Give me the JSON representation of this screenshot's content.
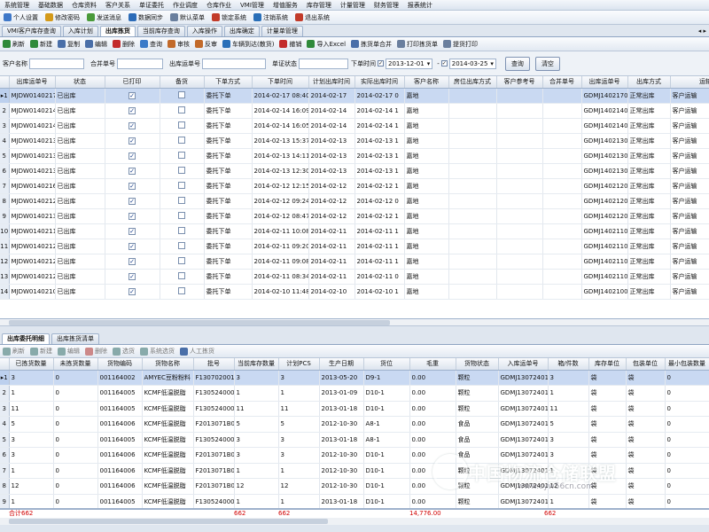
{
  "menu": [
    "系统管理",
    "基础数据",
    "仓库资料",
    "客户关系",
    "单证委托",
    "作业调度",
    "仓库作业",
    "VMI管理",
    "增值服务",
    "库存管理",
    "计量管理",
    "财务管理",
    "报表统计"
  ],
  "quickbar": [
    {
      "label": "个人设置",
      "icon": "person-icon",
      "color": "#3f78c8"
    },
    {
      "label": "修改密码",
      "icon": "key-icon",
      "color": "#d49a1a"
    },
    {
      "label": "发送消息",
      "icon": "message-icon",
      "color": "#4a9a3a"
    },
    {
      "label": "数据同步",
      "icon": "sync-icon",
      "color": "#2d6cb8"
    },
    {
      "label": "默认菜单",
      "icon": "menu-icon",
      "color": "#6a7f9e"
    },
    {
      "label": "锁定系统",
      "icon": "lock-icon",
      "color": "#c23b2a"
    },
    {
      "label": "注销系统",
      "icon": "logout-icon",
      "color": "#2a6fb8"
    },
    {
      "label": "退出系统",
      "icon": "exit-icon",
      "color": "#c23b2a"
    }
  ],
  "tabs": [
    "VMI客户库存查询",
    "入库计划",
    "出库拣货",
    "当前库存查询",
    "入库操作",
    "出库确定",
    "计量单管理"
  ],
  "active_tab": 2,
  "toolbar": [
    {
      "label": "刷新",
      "icon": "refresh-icon",
      "color": "#2f8a3a"
    },
    {
      "label": "新建",
      "icon": "new-icon",
      "color": "#2f8a3a"
    },
    {
      "label": "复制",
      "icon": "copy-icon",
      "color": "#4a6fa8"
    },
    {
      "label": "编辑",
      "icon": "edit-icon",
      "color": "#4a6fa8"
    },
    {
      "label": "删除",
      "icon": "delete-icon",
      "color": "#c32b2b"
    },
    {
      "label": "查询",
      "icon": "search-icon",
      "color": "#3a7ac8"
    },
    {
      "label": "审核",
      "icon": "approve-icon",
      "color": "#c26a2a"
    },
    {
      "label": "反审",
      "icon": "unapprove-icon",
      "color": "#c26a2a"
    },
    {
      "label": "车辆到达(散货)",
      "icon": "truck-icon",
      "color": "#2a6fb8"
    },
    {
      "label": "撤销",
      "icon": "undo-icon",
      "color": "#c32b2b"
    },
    {
      "label": "导入Excel",
      "icon": "excel-icon",
      "color": "#2f8a3a"
    },
    {
      "label": "拣货单合并",
      "icon": "merge-icon",
      "color": "#4a6fa8"
    },
    {
      "label": "打印拣货单",
      "icon": "print-icon",
      "color": "#6a7f9e"
    },
    {
      "label": "提货打印",
      "icon": "print-icon",
      "color": "#6a7f9e"
    }
  ],
  "filters": {
    "customer_label": "客户名称",
    "contract_label": "合并单号",
    "outbound_label": "出库运单号",
    "doc_status_label": "单证状态",
    "order_time_label": "下单时间",
    "date_from": "2013-12-01",
    "date_to": "2014-03-25",
    "query_button": "查询",
    "clear_button": "清空"
  },
  "grid1": {
    "columns": [
      "",
      "出库运单号",
      "状态",
      "已打印",
      "备货",
      "下单方式",
      "下单时间",
      "计划出库时间",
      "实际出库时间",
      "客户名称",
      "房位出库方式",
      "客户参考号",
      "合并单号",
      "出库运单号",
      "出库方式",
      "运输方式"
    ],
    "selected_row": 0,
    "rows": [
      [
        "1",
        "MJDW0140217001",
        "已出库",
        "✓",
        "",
        "委托下单",
        "2014-02-17 08:40",
        "2014-02-17",
        "2014-02-17 0",
        "嘉地",
        "",
        "",
        "",
        "GDMJ14021701",
        "正常出库",
        "客户运输"
      ],
      [
        "2",
        "MJDW0140214002",
        "已出库",
        "✓",
        "",
        "委托下单",
        "2014-02-14 16:09",
        "2014-02-14",
        "2014-02-14 1",
        "嘉地",
        "",
        "",
        "",
        "GDMJ14021402",
        "正常出库",
        "客户运输"
      ],
      [
        "3",
        "MJDW0140214001",
        "已出库",
        "✓",
        "",
        "委托下单",
        "2014-02-14 16:05",
        "2014-02-14",
        "2014-02-14 1",
        "嘉地",
        "",
        "",
        "",
        "GDMJ14021401",
        "正常出库",
        "客户运输"
      ],
      [
        "4",
        "MJDW0140213004",
        "已出库",
        "✓",
        "",
        "委托下单",
        "2014-02-13 15:37",
        "2014-02-13",
        "2014-02-13 1",
        "嘉地",
        "",
        "",
        "",
        "GDMJ14021304",
        "正常出库",
        "客户运输"
      ],
      [
        "5",
        "MJDW0140213003",
        "已出库",
        "✓",
        "",
        "委托下单",
        "2014-02-13 14:11",
        "2014-02-13",
        "2014-02-13 1",
        "嘉地",
        "",
        "",
        "",
        "GDMJ14021303",
        "正常出库",
        "客户运输"
      ],
      [
        "6",
        "MJDW0140213005",
        "已出库",
        "✓",
        "",
        "委托下单",
        "2014-02-13 12:30",
        "2014-02-13",
        "2014-02-13 1",
        "嘉地",
        "",
        "",
        "",
        "GDMJ14021305",
        "正常出库",
        "客户运输"
      ],
      [
        "7",
        "MJDW0140216001",
        "已出库",
        "✓",
        "",
        "委托下单",
        "2014-02-12 12:15",
        "2014-02-12",
        "2014-02-12 1",
        "嘉地",
        "",
        "",
        "",
        "GDMJ14021203",
        "正常出库",
        "客户运输"
      ],
      [
        "8",
        "MJDW0140212005",
        "已出库",
        "✓",
        "",
        "委托下单",
        "2014-02-12 09:24",
        "2014-02-12",
        "2014-02-12 0",
        "嘉地",
        "",
        "",
        "",
        "GDMJ14021201",
        "正常出库",
        "客户运输"
      ],
      [
        "9",
        "MJDW0140213001",
        "已出库",
        "✓",
        "",
        "委托下单",
        "2014-02-12 08:47",
        "2014-02-12",
        "2014-02-12 1",
        "嘉地",
        "",
        "",
        "",
        "GDMJ14021202",
        "正常出库",
        "客户运输"
      ],
      [
        "10",
        "MJDW0140211004",
        "已出库",
        "✓",
        "",
        "委托下单",
        "2014-02-11 10:08",
        "2014-02-11",
        "2014-02-11 1",
        "嘉地",
        "",
        "",
        "",
        "GDMJ14021104",
        "正常出库",
        "客户运输"
      ],
      [
        "11",
        "MJDW0140212004",
        "已出库",
        "✓",
        "",
        "委托下单",
        "2014-02-11 09:20",
        "2014-02-11",
        "2014-02-11 1",
        "嘉地",
        "",
        "",
        "",
        "GDMJ14021103",
        "正常出库",
        "客户运输"
      ],
      [
        "12",
        "MJDW0140212002",
        "已出库",
        "✓",
        "",
        "委托下单",
        "2014-02-11 09:08",
        "2014-02-11",
        "2014-02-11 1",
        "嘉地",
        "",
        "",
        "",
        "GDMJ14021102",
        "正常出库",
        "客户运输"
      ],
      [
        "13",
        "MJDW0140212001",
        "已出库",
        "✓",
        "",
        "委托下单",
        "2014-02-11 08:34",
        "2014-02-11",
        "2014-02-11 0",
        "嘉地",
        "",
        "",
        "",
        "GDMJ14021101",
        "正常出库",
        "客户运输"
      ],
      [
        "14",
        "MJDW0140210002",
        "已出库",
        "✓",
        "",
        "委托下单",
        "2014-02-10 11:48",
        "2014-02-10",
        "2014-02-10 1",
        "嘉地",
        "",
        "",
        "",
        "GDMJ14021001",
        "正常出库",
        "客户运输"
      ]
    ]
  },
  "tabs2": [
    "出库委托明细",
    "出库拣货清单"
  ],
  "toolbar2": [
    {
      "label": "刷新",
      "icon": "refresh-icon",
      "color": "#8aa"
    },
    {
      "label": "新建",
      "icon": "new-icon",
      "color": "#8aa"
    },
    {
      "label": "编辑",
      "icon": "edit-icon",
      "color": "#8aa"
    },
    {
      "label": "删除",
      "icon": "delete-icon",
      "color": "#c88"
    },
    {
      "label": "选货",
      "icon": "pick-icon",
      "color": "#8aa"
    },
    {
      "label": "系统选货",
      "icon": "auto-pick-icon",
      "color": "#8aa"
    },
    {
      "label": "人工拣货",
      "icon": "manual-pick-icon",
      "color": "#4a6fa8"
    }
  ],
  "grid2": {
    "columns": [
      "",
      "已拣货数量",
      "未拣货数量",
      "货物编码",
      "货物名称",
      "批号",
      "当前库存数量",
      "计划PCS",
      "生产日期",
      "货位",
      "毛重",
      "货物状态",
      "入库运单号",
      "箱/件数",
      "库存单位",
      "包装单位",
      "最小包装数量"
    ],
    "selected_row": 0,
    "rows": [
      [
        "1",
        "3",
        "0",
        "001164002",
        "AMYEC豆粉粉料",
        "F1307020014",
        "3",
        "3",
        "2013-05-20",
        "D9-1",
        "0.00",
        "颗粒",
        "GDMJ13072401",
        "3",
        "袋",
        "袋",
        "0"
      ],
      [
        "2",
        "1",
        "0",
        "001164005",
        "KCMF低温脱脂",
        "F1305240001",
        "1",
        "1",
        "2013-01-09",
        "D10-1",
        "0.00",
        "颗粒",
        "GDMJ13072401",
        "1",
        "袋",
        "袋",
        "0"
      ],
      [
        "3",
        "11",
        "0",
        "001164005",
        "KCMF低温脱脂",
        "F1305240001",
        "11",
        "11",
        "2013-01-18",
        "D10-1",
        "0.00",
        "颗粒",
        "GDMJ13072401",
        "11",
        "袋",
        "袋",
        "0"
      ],
      [
        "4",
        "5",
        "0",
        "001164006",
        "KCMF低温脱脂",
        "F2013071B0025",
        "5",
        "5",
        "2012-10-30",
        "A8-1",
        "0.00",
        "食品",
        "GDMJ13072401",
        "5",
        "袋",
        "袋",
        "0"
      ],
      [
        "5",
        "3",
        "0",
        "001164005",
        "KCMF低温脱脂",
        "F1305240001",
        "3",
        "3",
        "2013-01-18",
        "A8-1",
        "0.00",
        "食品",
        "GDMJ13072401",
        "3",
        "袋",
        "袋",
        "0"
      ],
      [
        "6",
        "3",
        "0",
        "001164006",
        "KCMF低温脱脂",
        "F2013071B0025",
        "3",
        "3",
        "2012-10-30",
        "D10-1",
        "0.00",
        "食品",
        "GDMJ13072401",
        "3",
        "袋",
        "袋",
        "0"
      ],
      [
        "7",
        "1",
        "0",
        "001164006",
        "KCMF低温脱脂",
        "F2013071B0025",
        "1",
        "1",
        "2012-10-30",
        "D10-1",
        "0.00",
        "颗粒",
        "GDMJ13072401",
        "1",
        "袋",
        "袋",
        "0"
      ],
      [
        "8",
        "12",
        "0",
        "001164006",
        "KCMF低温脱脂",
        "F2013071B0025",
        "12",
        "12",
        "2012-10-30",
        "D10-1",
        "0.00",
        "颗粒",
        "GDMJ13072401",
        "12",
        "袋",
        "袋",
        "0"
      ],
      [
        "9",
        "1",
        "0",
        "001164005",
        "KCMF低温脱脂",
        "F1305240001",
        "1",
        "1",
        "2013-01-18",
        "D10-1",
        "0.00",
        "颗粒",
        "GDMJ13072401",
        "1",
        "袋",
        "袋",
        "0"
      ]
    ]
  },
  "totals": {
    "label": "合计",
    "picked": "662",
    "current_stock": "662",
    "plan_pcs": "662",
    "gross_weight": "14,776.00",
    "cases": "662"
  },
  "watermark": {
    "text": "中国物流仓储联盟",
    "url": "www.cyw56cn.com"
  }
}
